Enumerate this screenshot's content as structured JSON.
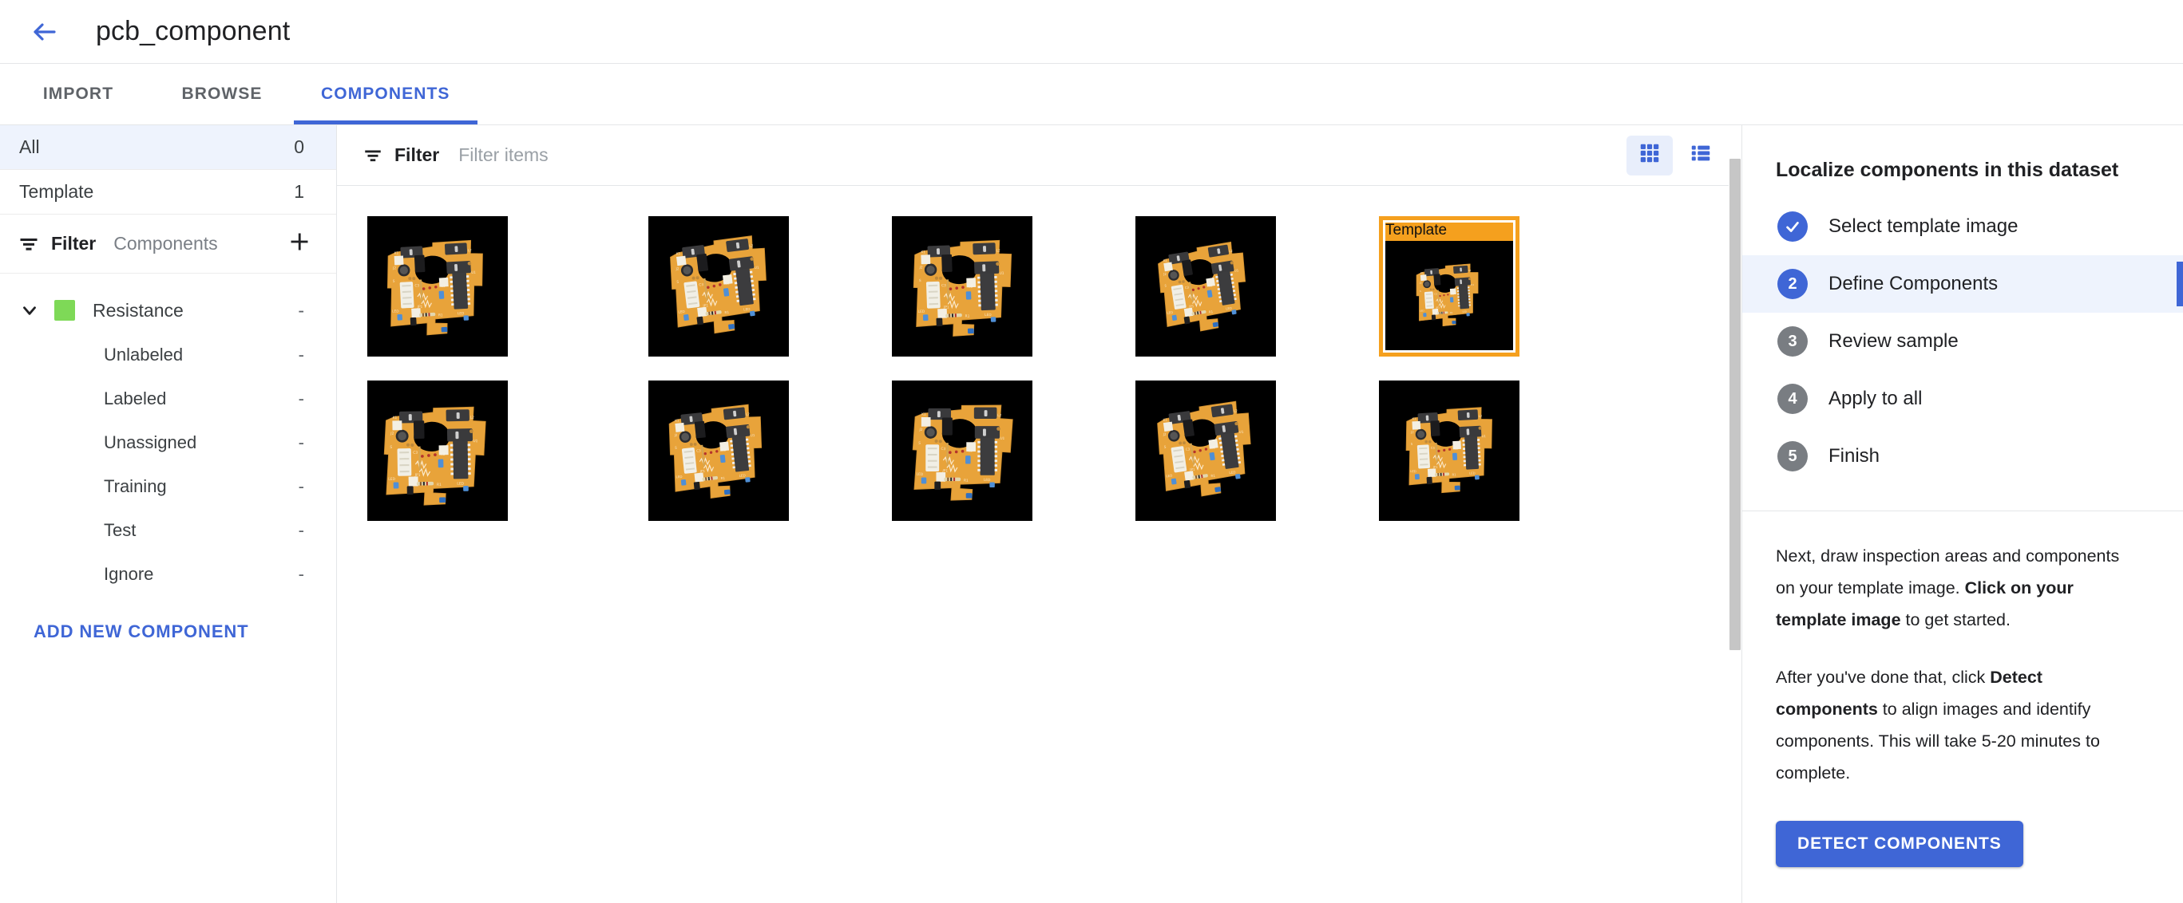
{
  "header": {
    "back_icon": "arrow-left-icon",
    "title": "pcb_component"
  },
  "tabs": [
    {
      "label": "IMPORT",
      "active": false
    },
    {
      "label": "BROWSE",
      "active": false
    },
    {
      "label": "COMPONENTS",
      "active": true
    }
  ],
  "sidebar": {
    "rows": [
      {
        "label": "All",
        "count": "0",
        "selected": true
      },
      {
        "label": "Template",
        "count": "1",
        "selected": false
      }
    ],
    "filter": {
      "icon": "filter-icon",
      "label": "Filter",
      "sub_label": "Components",
      "add_icon": "plus-icon"
    },
    "component": {
      "name": "Resistance",
      "color": "#7ED957",
      "count": "-",
      "expanded": true,
      "children": [
        {
          "label": "Unlabeled",
          "count": "-"
        },
        {
          "label": "Labeled",
          "count": "-"
        },
        {
          "label": "Unassigned",
          "count": "-"
        },
        {
          "label": "Training",
          "count": "-"
        },
        {
          "label": "Test",
          "count": "-"
        },
        {
          "label": "Ignore",
          "count": "-"
        }
      ]
    },
    "add_new_label": "ADD NEW COMPONENT"
  },
  "toolbar": {
    "filter_icon": "filter-icon",
    "filter_label": "Filter",
    "filter_placeholder": "Filter items",
    "filter_value": "",
    "grid_view_icon": "grid-view-icon",
    "list_view_icon": "list-view-icon",
    "active_view": "grid"
  },
  "gallery": {
    "template_badge": "Template",
    "rows": [
      [
        {
          "is_template": false
        },
        {
          "is_template": false
        },
        {
          "is_template": false
        },
        {
          "is_template": false
        },
        {
          "is_template": true
        }
      ],
      [
        {
          "is_template": false
        },
        {
          "is_template": false
        },
        {
          "is_template": false
        },
        {
          "is_template": false
        },
        {
          "is_template": false
        }
      ]
    ]
  },
  "right_panel": {
    "title": "Localize components in this dataset",
    "steps": [
      {
        "marker": "check",
        "label": "Select template image",
        "state": "done"
      },
      {
        "marker": "2",
        "label": "Define Components",
        "state": "current"
      },
      {
        "marker": "3",
        "label": "Review sample",
        "state": "pending"
      },
      {
        "marker": "4",
        "label": "Apply to all",
        "state": "pending"
      },
      {
        "marker": "5",
        "label": "Finish",
        "state": "pending"
      }
    ],
    "paragraph1_a": "Next, draw inspection areas and components on your template image. ",
    "paragraph1_b": "Click on your template image",
    "paragraph1_c": " to get started.",
    "paragraph2_a": "After you've done that, click ",
    "paragraph2_b": "Detect components",
    "paragraph2_c": " to align images and identify components. This will take 5-20 minutes to complete.",
    "detect_button": "DETECT COMPONENTS"
  },
  "colors": {
    "accent": "#3f66d6",
    "template_orange": "#f5a01e",
    "component_green": "#7ED957",
    "selected_row_bg": "#eef3fd"
  }
}
